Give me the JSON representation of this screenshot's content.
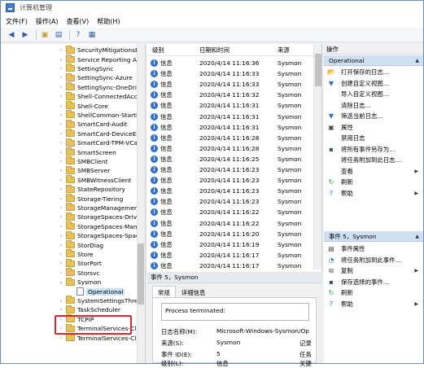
{
  "window": {
    "title": "计算机管理"
  },
  "menu": [
    "文件(F)",
    "操作(A)",
    "查看(V)",
    "帮助(H)"
  ],
  "toolbar": {
    "icons": [
      "back-icon",
      "forward-icon",
      "up-folder-icon",
      "console-tree-icon",
      "help-icon",
      "properties-icon"
    ]
  },
  "tree": {
    "items": [
      {
        "label": "SecurityMitigationsBr",
        "expander": "›"
      },
      {
        "label": "Service Reporting AP",
        "expander": "›"
      },
      {
        "label": "SettingSync",
        "expander": "›"
      },
      {
        "label": "SettingSync-Azure",
        "expander": "›"
      },
      {
        "label": "SettingSync-OneDriv",
        "expander": "›"
      },
      {
        "label": "Shell-ConnectedAcco",
        "expander": "›"
      },
      {
        "label": "Shell-Core",
        "expander": "›"
      },
      {
        "label": "ShellCommon-StartLa",
        "expander": "›"
      },
      {
        "label": "SmartCard-Audit",
        "expander": "›"
      },
      {
        "label": "SmartCard-DeviceEnu",
        "expander": "›"
      },
      {
        "label": "SmartCard-TPM-VCar",
        "expander": "›"
      },
      {
        "label": "SmartScreen",
        "expander": "›"
      },
      {
        "label": "SMBClient",
        "expander": "›"
      },
      {
        "label": "SMBServer",
        "expander": "›"
      },
      {
        "label": "SMBWitnessClient",
        "expander": "›"
      },
      {
        "label": "StateRepository",
        "expander": "›"
      },
      {
        "label": "Storage-Tiering",
        "expander": "›"
      },
      {
        "label": "StorageManagement",
        "expander": "›"
      },
      {
        "label": "StorageSpaces-Driver",
        "expander": "›"
      },
      {
        "label": "StorageSpaces-Mana",
        "expander": "›"
      },
      {
        "label": "StorageSpaces-Space",
        "expander": "›"
      },
      {
        "label": "StorDiag",
        "expander": "›"
      },
      {
        "label": "Store",
        "expander": "›"
      },
      {
        "label": "StorPort",
        "expander": "›"
      },
      {
        "label": "Storsvc",
        "expander": "›"
      },
      {
        "label": "Sysmon",
        "expander": "⌄"
      },
      {
        "label": "Operational",
        "expander": "",
        "child": true
      },
      {
        "label": "SystemSettingsThresl",
        "expander": "›"
      },
      {
        "label": "TaskScheduler",
        "expander": "›"
      },
      {
        "label": "TCPIP",
        "expander": "›"
      },
      {
        "label": "TerminalServices-Clie",
        "expander": "›"
      },
      {
        "label": "TerminalServices-Clie",
        "expander": "›"
      }
    ]
  },
  "events": {
    "columns": [
      "级别",
      "日期和时间",
      "来源"
    ],
    "rows": [
      {
        "level": "信息",
        "datetime": "2020/4/14 11:16:36",
        "source": "Sysmon"
      },
      {
        "level": "信息",
        "datetime": "2020/4/14 11:16:33",
        "source": "Sysmon"
      },
      {
        "level": "信息",
        "datetime": "2020/4/14 11:16:33",
        "source": "Sysmon"
      },
      {
        "level": "信息",
        "datetime": "2020/4/14 11:16:32",
        "source": "Sysmon"
      },
      {
        "level": "信息",
        "datetime": "2020/4/14 11:16:31",
        "source": "Sysmon"
      },
      {
        "level": "信息",
        "datetime": "2020/4/14 11:16:31",
        "source": "Sysmon"
      },
      {
        "level": "信息",
        "datetime": "2020/4/14 11:16:31",
        "source": "Sysmon"
      },
      {
        "level": "信息",
        "datetime": "2020/4/14 11:16:28",
        "source": "Sysmon"
      },
      {
        "level": "信息",
        "datetime": "2020/4/14 11:16:28",
        "source": "Sysmon"
      },
      {
        "level": "信息",
        "datetime": "2020/4/14 11:16:25",
        "source": "Sysmon"
      },
      {
        "level": "信息",
        "datetime": "2020/4/14 11:16:23",
        "source": "Sysmon"
      },
      {
        "level": "信息",
        "datetime": "2020/4/14 11:16:23",
        "source": "Sysmon"
      },
      {
        "level": "信息",
        "datetime": "2020/4/14 11:16:23",
        "source": "Sysmon"
      },
      {
        "level": "信息",
        "datetime": "2020/4/14 11:16:23",
        "source": "Sysmon"
      },
      {
        "level": "信息",
        "datetime": "2020/4/14 11:16:22",
        "source": "Sysmon"
      },
      {
        "level": "信息",
        "datetime": "2020/4/14 11:16:22",
        "source": "Sysmon"
      },
      {
        "level": "信息",
        "datetime": "2020/4/14 11:16:20",
        "source": "Sysmon"
      },
      {
        "level": "信息",
        "datetime": "2020/4/14 11:16:19",
        "source": "Sysmon"
      },
      {
        "level": "信息",
        "datetime": "2020/4/14 11:16:17",
        "source": "Sysmon"
      },
      {
        "level": "信息",
        "datetime": "2020/4/14 11:16:17",
        "source": "Sysmon"
      }
    ]
  },
  "detail": {
    "header": "事件 5，Sysmon",
    "tabs": [
      "常规",
      "详细信息"
    ],
    "message": "Process terminated:",
    "fields": [
      {
        "label": "日志名称(M):",
        "value": "Microsoft-Windows-Sysmon/Op"
      },
      {
        "label": "来源(S):",
        "value": "Sysmon",
        "extra": "记录"
      },
      {
        "label": "事件 ID(E):",
        "value": "5",
        "extra": "任务"
      },
      {
        "label": "级别(L):",
        "value": "信息",
        "extra": "关键"
      }
    ]
  },
  "actions": {
    "title": "操作",
    "section1": "Operational",
    "items1": [
      {
        "label": "打开保存的日志...",
        "icon": "folder-open-icon"
      },
      {
        "label": "创建自定义视图...",
        "icon": "filter-create-icon"
      },
      {
        "label": "导入自定义视图...",
        "icon": "import-icon"
      },
      {
        "label": "清除日志...",
        "icon": ""
      },
      {
        "label": "筛选当前日志...",
        "icon": "filter-icon"
      },
      {
        "label": "属性",
        "icon": "properties-icon"
      },
      {
        "label": "禁用日志",
        "icon": ""
      },
      {
        "label": "将所有事件另存为...",
        "icon": "save-icon"
      },
      {
        "label": "将任务附加到此日志...",
        "icon": ""
      },
      {
        "label": "查看",
        "icon": "",
        "arrow": "▶"
      },
      {
        "label": "刷新",
        "icon": "refresh-icon"
      },
      {
        "label": "帮助",
        "icon": "help-icon",
        "arrow": "▶"
      }
    ],
    "section2": "事件 5，Sysmon",
    "items2": [
      {
        "label": "事件属性",
        "icon": "event-props-icon"
      },
      {
        "label": "将任务附加到此事件...",
        "icon": "task-icon"
      },
      {
        "label": "复制",
        "icon": "copy-icon",
        "arrow": "▶"
      },
      {
        "label": "保存选择的事件...",
        "icon": "save-icon"
      },
      {
        "label": "刷新",
        "icon": "refresh-icon"
      },
      {
        "label": "帮助",
        "icon": "help-icon",
        "arrow": "▶"
      }
    ]
  }
}
